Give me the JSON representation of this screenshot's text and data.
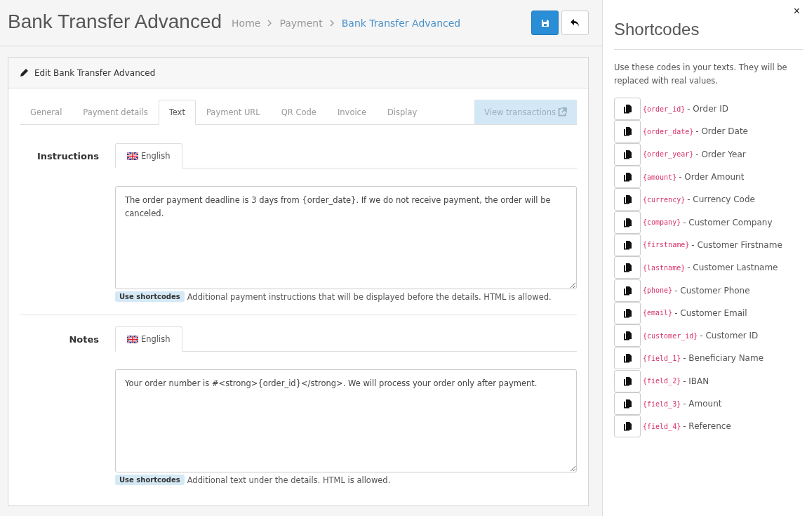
{
  "header": {
    "title": "Bank Transfer Advanced",
    "breadcrumb": [
      {
        "label": "Home",
        "current": false
      },
      {
        "label": "Payment",
        "current": false
      },
      {
        "label": "Bank Transfer Advanced",
        "current": true
      }
    ]
  },
  "panel": {
    "title": "Edit Bank Transfer Advanced",
    "tabs": [
      {
        "label": "General",
        "selected": false
      },
      {
        "label": "Payment details",
        "selected": false
      },
      {
        "label": "Text",
        "selected": true
      },
      {
        "label": "Payment URL",
        "selected": false
      },
      {
        "label": "QR Code",
        "selected": false
      },
      {
        "label": "Invoice",
        "selected": false
      },
      {
        "label": "Display",
        "selected": false
      }
    ],
    "view_transactions": "View transactions",
    "fields": [
      {
        "label": "Instructions",
        "language_tab": {
          "label": "English",
          "selected": true
        },
        "value": "The order payment deadline is 3 days from {order_date}. If we do not receive payment, the order will be canceled.",
        "badge": "Use shortcodes",
        "help": "Additional payment instructions that will be displayed before the details. HTML is allowed."
      },
      {
        "label": "Notes",
        "language_tab": {
          "label": "English",
          "selected": true
        },
        "value": "Your order number is #<strong>{order_id}</strong>. We will process your order only after payment.",
        "badge": "Use shortcodes",
        "help": "Additional text under the details. HTML is allowed."
      }
    ]
  },
  "sidebar": {
    "close": "×",
    "title": "Shortcodes",
    "intro": "Use these codes in your texts. They will be replaced with real values.",
    "shortcodes": [
      {
        "code": "{order_id}",
        "label": "- Order ID"
      },
      {
        "code": "{order_date}",
        "label": "- Order Date"
      },
      {
        "code": "{order_year}",
        "label": "- Order Year"
      },
      {
        "code": "{amount}",
        "label": "- Order Amount"
      },
      {
        "code": "{currency}",
        "label": "- Currency Code"
      },
      {
        "code": "{company}",
        "label": "- Customer Company"
      },
      {
        "code": "{firstname}",
        "label": "- Customer Firstname"
      },
      {
        "code": "{lastname}",
        "label": "- Customer Lastname"
      },
      {
        "code": "{phone}",
        "label": "- Customer Phone"
      },
      {
        "code": "{email}",
        "label": "- Customer Email"
      },
      {
        "code": "{customer_id}",
        "label": "- Customer ID"
      },
      {
        "code": "{field_1}",
        "label": "- Beneficiary Name"
      },
      {
        "code": "{field_2}",
        "label": "- IBAN"
      },
      {
        "code": "{field_3}",
        "label": "- Amount"
      },
      {
        "code": "{field_4}",
        "label": "- Reference"
      }
    ]
  }
}
